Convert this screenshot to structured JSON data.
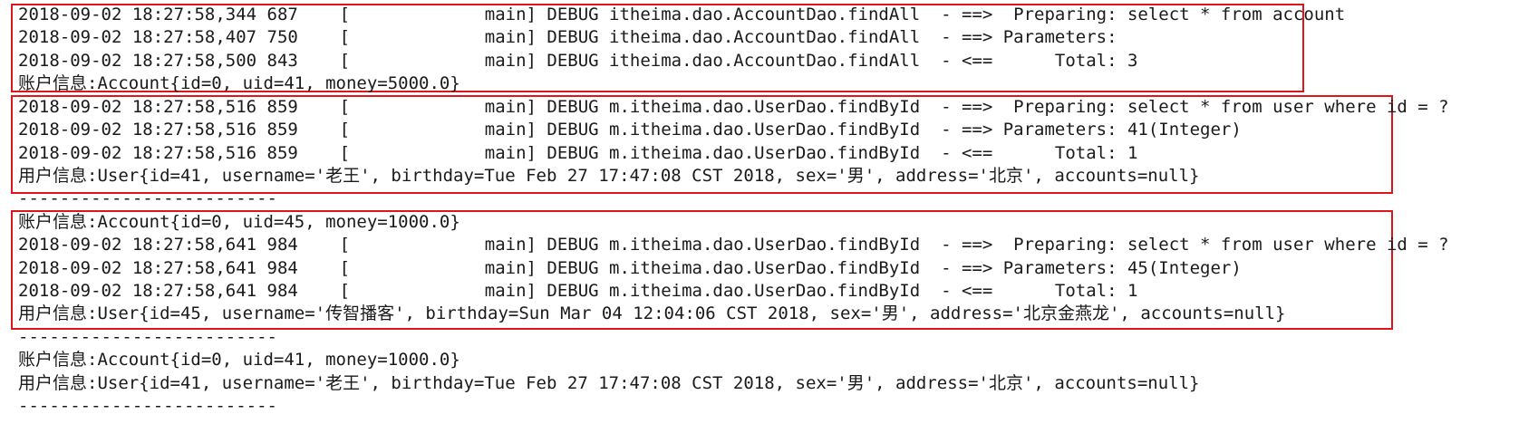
{
  "console": {
    "lines": [
      "2018-09-02 18:27:58,344 687    [             main] DEBUG itheima.dao.AccountDao.findAll  - ==>  Preparing: select * from account",
      "2018-09-02 18:27:58,407 750    [             main] DEBUG itheima.dao.AccountDao.findAll  - ==> Parameters:",
      "2018-09-02 18:27:58,500 843    [             main] DEBUG itheima.dao.AccountDao.findAll  - <==      Total: 3",
      "账户信息:Account{id=0, uid=41, money=5000.0}",
      "2018-09-02 18:27:58,516 859    [             main] DEBUG m.itheima.dao.UserDao.findById  - ==>  Preparing: select * from user where id = ?",
      "2018-09-02 18:27:58,516 859    [             main] DEBUG m.itheima.dao.UserDao.findById  - ==> Parameters: 41(Integer)",
      "2018-09-02 18:27:58,516 859    [             main] DEBUG m.itheima.dao.UserDao.findById  - <==      Total: 1",
      "用户信息:User{id=41, username='老王', birthday=Tue Feb 27 17:47:08 CST 2018, sex='男', address='北京', accounts=null}",
      "-------------------------",
      "账户信息:Account{id=0, uid=45, money=1000.0}",
      "2018-09-02 18:27:58,641 984    [             main] DEBUG m.itheima.dao.UserDao.findById  - ==>  Preparing: select * from user where id = ?",
      "2018-09-02 18:27:58,641 984    [             main] DEBUG m.itheima.dao.UserDao.findById  - ==> Parameters: 45(Integer)",
      "2018-09-02 18:27:58,641 984    [             main] DEBUG m.itheima.dao.UserDao.findById  - <==      Total: 1",
      "用户信息:User{id=45, username='传智播客', birthday=Sun Mar 04 12:04:06 CST 2018, sex='男', address='北京金燕龙', accounts=null}",
      "-------------------------",
      "账户信息:Account{id=0, uid=41, money=1000.0}",
      "用户信息:User{id=41, username='老王', birthday=Tue Feb 27 17:47:08 CST 2018, sex='男', address='北京', accounts=null}",
      "-------------------------"
    ],
    "highlight_color": "#e0151b"
  }
}
